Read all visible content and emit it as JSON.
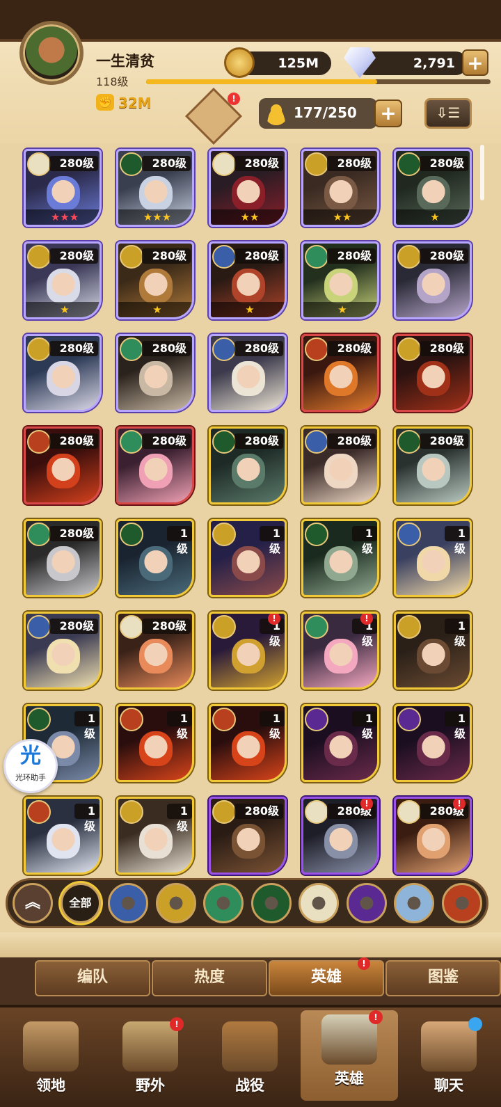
{
  "player": {
    "name": "一生清贫",
    "level": "118级",
    "power": "32M",
    "xp_fraction": 0.67
  },
  "resources": {
    "gold": "125M",
    "diamonds": "2,791",
    "hero_count": "177/250"
  },
  "icons": {
    "plus": "+",
    "sort": "⇩☰",
    "power": "✊",
    "notif": "!"
  },
  "heroes": [
    {
      "level": "280级",
      "frame": "purple",
      "faction": "celestial",
      "stars": "★★★",
      "star_color": "red"
    },
    {
      "level": "280级",
      "frame": "purple",
      "faction": "wilder",
      "stars": "★★★",
      "star_color": "gold"
    },
    {
      "level": "280级",
      "frame": "purple",
      "faction": "celestial",
      "stars": "★★",
      "star_color": "gold"
    },
    {
      "level": "280级",
      "frame": "purple",
      "faction": "graveborn",
      "stars": "★★",
      "star_color": "gold"
    },
    {
      "level": "280级",
      "frame": "purple",
      "faction": "wilder",
      "stars": "★",
      "star_color": "gold"
    },
    {
      "level": "280级",
      "frame": "purple",
      "faction": "graveborn",
      "stars": "★",
      "star_color": "gold"
    },
    {
      "level": "280级",
      "frame": "purple",
      "faction": "graveborn",
      "stars": "★",
      "star_color": "gold"
    },
    {
      "level": "280级",
      "frame": "purple",
      "faction": "lightbearer",
      "stars": "★",
      "star_color": "gold"
    },
    {
      "level": "280级",
      "frame": "purple",
      "faction": "maulers",
      "stars": "★",
      "star_color": "gold"
    },
    {
      "level": "280级",
      "frame": "purple",
      "faction": "graveborn",
      "stars": "",
      "star_color": "gold"
    },
    {
      "level": "280级",
      "frame": "purple",
      "faction": "graveborn",
      "stars": "",
      "star_color": "gold"
    },
    {
      "level": "280级",
      "frame": "purple",
      "faction": "maulers",
      "stars": "",
      "star_color": "gold"
    },
    {
      "level": "280级",
      "frame": "purple",
      "faction": "lightbearer",
      "stars": "",
      "star_color": "gold"
    },
    {
      "level": "280级",
      "frame": "red",
      "faction": "dimensional",
      "stars": "",
      "star_color": "gold"
    },
    {
      "level": "280级",
      "frame": "red",
      "faction": "graveborn",
      "stars": "",
      "star_color": "gold"
    },
    {
      "level": "280级",
      "frame": "red",
      "faction": "dimensional",
      "stars": "",
      "star_color": "gold"
    },
    {
      "level": "280级",
      "frame": "red",
      "faction": "maulers",
      "stars": "",
      "star_color": "gold"
    },
    {
      "level": "280级",
      "frame": "gold",
      "faction": "wilder",
      "stars": "",
      "star_color": "gold"
    },
    {
      "level": "280级",
      "frame": "gold",
      "faction": "lightbearer",
      "stars": "",
      "star_color": "gold"
    },
    {
      "level": "280级",
      "frame": "gold",
      "faction": "wilder",
      "stars": "",
      "star_color": "gold"
    },
    {
      "level": "280级",
      "frame": "gold",
      "faction": "maulers",
      "stars": "",
      "star_color": "gold"
    },
    {
      "level": "1级",
      "frame": "gold",
      "faction": "wilder",
      "stars": "",
      "star_color": "gold"
    },
    {
      "level": "1级",
      "frame": "gold",
      "faction": "graveborn",
      "stars": "",
      "star_color": "gold"
    },
    {
      "level": "1级",
      "frame": "gold",
      "faction": "wilder",
      "stars": "",
      "star_color": "gold"
    },
    {
      "level": "1级",
      "frame": "gold",
      "faction": "lightbearer",
      "stars": "",
      "star_color": "gold"
    },
    {
      "level": "280级",
      "frame": "gold",
      "faction": "lightbearer",
      "stars": "",
      "star_color": "gold"
    },
    {
      "level": "280级",
      "frame": "gold",
      "faction": "celestial",
      "stars": "",
      "star_color": "gold"
    },
    {
      "level": "1级",
      "frame": "gold",
      "faction": "graveborn",
      "stars": "",
      "star_color": "gold",
      "notif": true
    },
    {
      "level": "1级",
      "frame": "gold",
      "faction": "maulers",
      "stars": "",
      "star_color": "gold",
      "notif": true
    },
    {
      "level": "1级",
      "frame": "gold",
      "faction": "graveborn",
      "stars": "",
      "star_color": "gold"
    },
    {
      "level": "1级",
      "frame": "gold",
      "faction": "wilder",
      "stars": "",
      "star_color": "gold"
    },
    {
      "level": "1级",
      "frame": "gold",
      "faction": "dimensional",
      "stars": "",
      "star_color": "gold"
    },
    {
      "level": "1级",
      "frame": "gold",
      "faction": "dimensional",
      "stars": "",
      "star_color": "gold"
    },
    {
      "level": "1级",
      "frame": "gold",
      "faction": "hypogean",
      "stars": "",
      "star_color": "gold"
    },
    {
      "level": "1级",
      "frame": "gold",
      "faction": "hypogean",
      "stars": "",
      "star_color": "gold"
    },
    {
      "level": "1级",
      "frame": "gold",
      "faction": "dimensional",
      "stars": "",
      "star_color": "gold"
    },
    {
      "level": "1级",
      "frame": "gold",
      "faction": "graveborn",
      "stars": "",
      "star_color": "gold"
    },
    {
      "level": "280级",
      "frame": "violet",
      "faction": "graveborn",
      "stars": "",
      "star_color": "gold"
    },
    {
      "level": "280级",
      "frame": "violet",
      "faction": "celestial",
      "stars": "",
      "star_color": "gold",
      "notif": true
    },
    {
      "level": "280级",
      "frame": "violet",
      "faction": "celestial",
      "stars": "",
      "star_color": "gold",
      "notif": true
    }
  ],
  "helper": {
    "glyph": "光",
    "label": "光环助手"
  },
  "filters": {
    "all_label": "全部",
    "items": [
      "up-arrows",
      "all",
      "lightbearer",
      "graveborn",
      "maulers",
      "wilder",
      "celestial",
      "hypogean",
      "tidal",
      "dimensional"
    ]
  },
  "subtabs": [
    "编队",
    "热度",
    "英雄",
    "图鉴"
  ],
  "active_subtab": "英雄",
  "bottom_nav": [
    "领地",
    "野外",
    "战役",
    "英雄",
    "聊天"
  ],
  "active_nav": "英雄",
  "colors": {
    "lightbearer": "#3b5ea8",
    "graveborn": "#caa027",
    "maulers": "#2f8c5b",
    "wilder": "#1f5a2c",
    "celestial": "#e9e0c2",
    "hypogean": "#5a2a92",
    "tidal": "#8fb4da",
    "dimensional": "#b8401e"
  }
}
